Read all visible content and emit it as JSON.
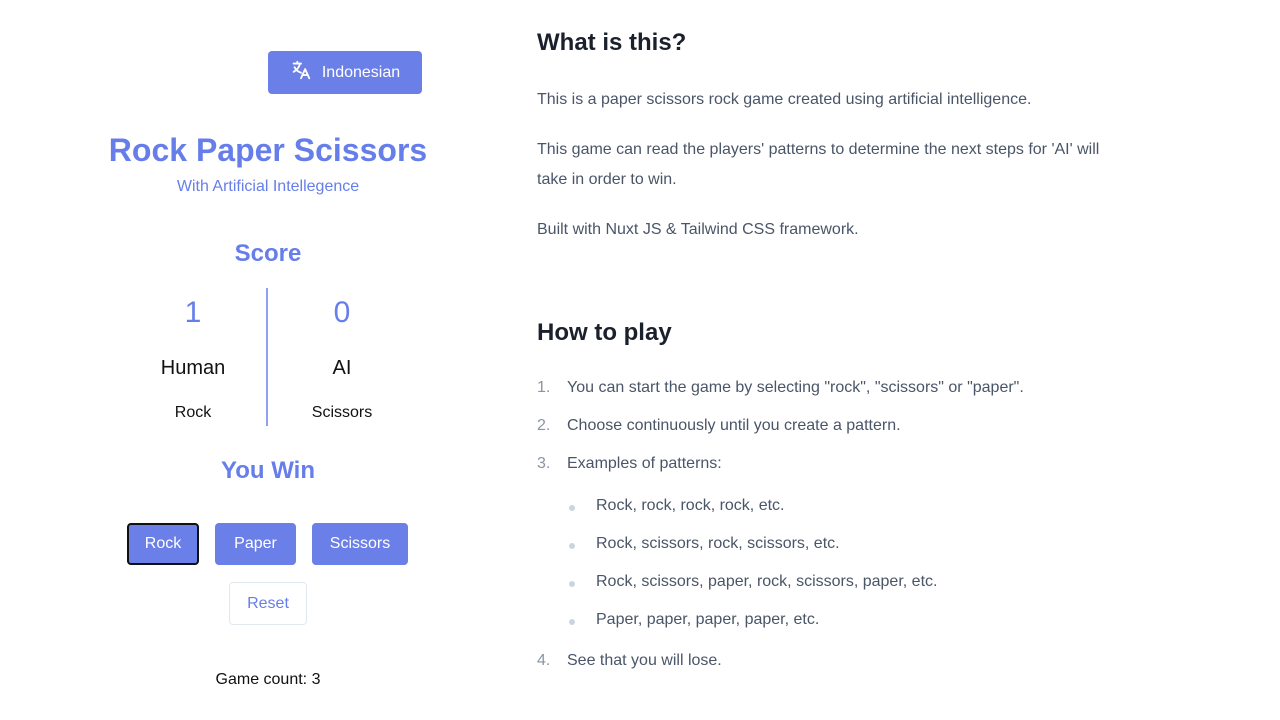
{
  "language_button": {
    "label": "Indonesian",
    "icon": "translate-icon"
  },
  "game": {
    "title": "Rock Paper Scissors",
    "subtitle": "With Artificial Intellegence",
    "score_heading": "Score",
    "human": {
      "score": "1",
      "name": "Human",
      "choice": "Rock"
    },
    "ai": {
      "score": "0",
      "name": "AI",
      "choice": "Scissors"
    },
    "result": "You Win",
    "choices": {
      "rock": "Rock",
      "paper": "Paper",
      "scissors": "Scissors"
    },
    "reset_label": "Reset",
    "game_count": "Game count: 3"
  },
  "info": {
    "what_heading": "What is this?",
    "what_p1": "This is a paper scissors rock game created using artificial intelligence.",
    "what_p2": "This game can read the players' patterns to determine the next steps for 'AI' will take in order to win.",
    "what_p3": "Built with Nuxt JS & Tailwind CSS framework.",
    "how_heading": "How to play",
    "steps": [
      {
        "num": "1.",
        "text": "You can start the game by selecting \"rock\", \"scissors\" or \"paper\"."
      },
      {
        "num": "2.",
        "text": "Choose continuously until you create a pattern."
      },
      {
        "num": "3.",
        "text": "Examples of patterns:"
      },
      {
        "num": "4.",
        "text": "See that you will lose."
      }
    ],
    "patterns": [
      "Rock, rock, rock, rock, etc.",
      "Rock, scissors, rock, scissors, etc.",
      "Rock, scissors, paper, rock, scissors, paper, etc.",
      "Paper, paper, paper, paper, etc."
    ]
  },
  "colors": {
    "accent": "#667eea",
    "button": "#6b7fe8",
    "text": "#1a202c",
    "muted": "#4a5568"
  }
}
